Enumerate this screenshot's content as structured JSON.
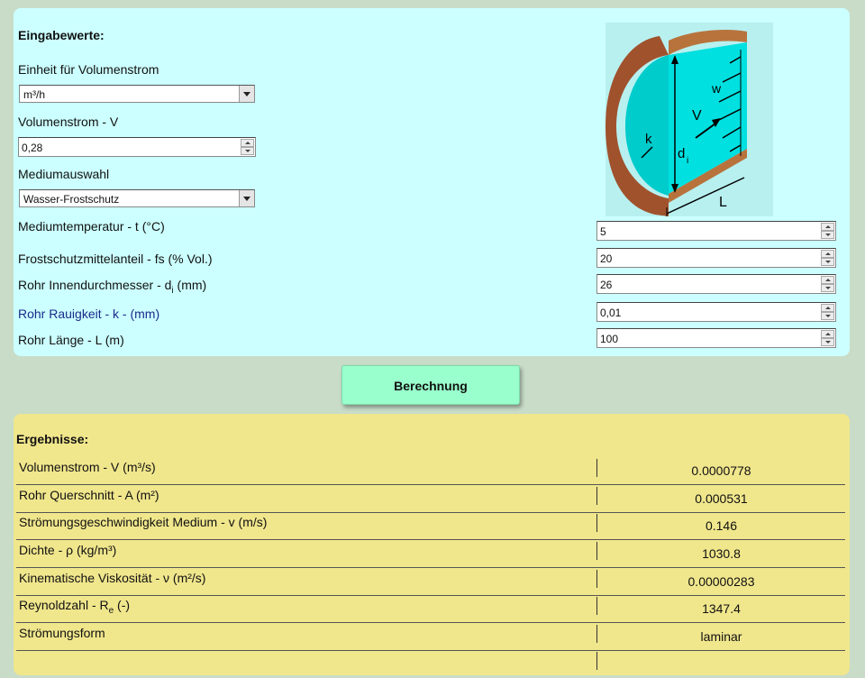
{
  "input_panel": {
    "title": "Eingabewerte:",
    "unit_label": "Einheit für Volumenstrom",
    "unit_value": "m³/h",
    "flow_label": "Volumenstrom - V",
    "flow_value": "0,28",
    "medium_label": "Mediumauswahl",
    "medium_value": "Wasser-Frostschutz",
    "temp_label": "Mediumtemperatur - t (°C)",
    "temp_value": "5",
    "antifreeze_label": "Frostschutzmittelanteil - fs (% Vol.)",
    "antifreeze_value": "20",
    "diameter_label_pre": "Rohr Innendurchmesser - d",
    "diameter_label_sub": "i",
    "diameter_label_post": " (mm)",
    "diameter_value": "26",
    "roughness_label": "Rohr Rauigkeit - k - (mm)",
    "roughness_value": "0,01",
    "length_label": "Rohr Länge - L (m)",
    "length_value": "100",
    "image": {
      "label_w": "w",
      "label_v": "V",
      "label_k": "k",
      "label_d": "d",
      "label_d_sub": "i",
      "label_l": "L"
    }
  },
  "calc_button": "Berechnung",
  "results": {
    "title": "Ergebnisse:",
    "rows": [
      {
        "label": "Volumenstrom - V (m³/s)",
        "value": "0.0000778"
      },
      {
        "label": "Rohr Querschnitt - A (m²)",
        "value": "0.000531"
      },
      {
        "label": "Strömungsgeschwindigkeit Medium - v (m/s)",
        "value": "0.146"
      },
      {
        "label": "Dichte - ρ (kg/m³)",
        "value": "1030.8"
      },
      {
        "label": "Kinematische Viskosität - ν (m²/s)",
        "value": "0.00000283"
      },
      {
        "label_pre": "Reynoldzahl - R",
        "label_sub": "e",
        "label_post": " (-)",
        "value": "1347.4"
      },
      {
        "label": "Strömungsform",
        "value": "laminar"
      }
    ]
  },
  "colors": {
    "page_bg": "#c8dcc8",
    "input_bg": "#ccffff",
    "result_bg": "#f0e68c",
    "button_bg": "#99ffcc",
    "pipe_fluid": "#00e0e0",
    "pipe_wall": "#a0522d"
  }
}
